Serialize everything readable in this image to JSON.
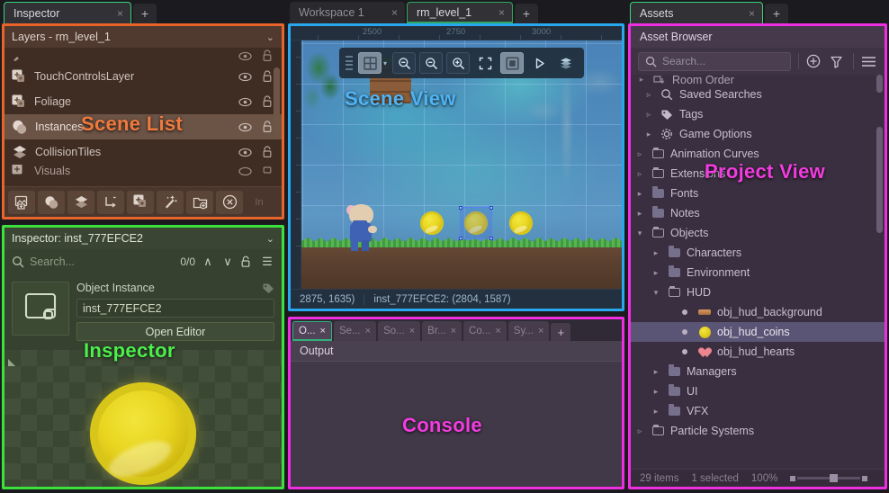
{
  "left_tabs": {
    "items": [
      {
        "label": "Inspector",
        "close": "×"
      }
    ],
    "add": "+"
  },
  "center_tabs": {
    "items": [
      {
        "label": "Workspace 1",
        "close": "×"
      },
      {
        "label": "rm_level_1",
        "close": "×"
      }
    ],
    "add": "+"
  },
  "right_tabs": {
    "items": [
      {
        "label": "Assets",
        "close": "×"
      }
    ],
    "add": "+"
  },
  "scene_list": {
    "overlay_label": "Scene List",
    "header": "Layers - rm_level_1",
    "collapse_icon": "⌄",
    "layers": [
      {
        "name": "",
        "icon": "brush",
        "partial": true,
        "eye": "👁",
        "lock": "🔓"
      },
      {
        "name": "TouchControlsLayer",
        "icon": "asset",
        "eye": "👁",
        "lock": "🔓"
      },
      {
        "name": "Foliage",
        "icon": "asset",
        "eye": "👁",
        "lock": "🔓"
      },
      {
        "name": "Instances",
        "icon": "instance",
        "selected": true,
        "eye": "👁",
        "lock": "🔓"
      },
      {
        "name": "CollisionTiles",
        "icon": "tile",
        "eye": "👁",
        "lock": "🔓"
      },
      {
        "name": "Visuals",
        "icon": "asset",
        "partial_bottom": true,
        "eye": "👁",
        "lock": "🔓"
      }
    ],
    "toolbar": [
      {
        "name": "background-layer-button",
        "icon": "image"
      },
      {
        "name": "instance-layer-button",
        "icon": "instance"
      },
      {
        "name": "tile-layer-button",
        "icon": "tiles"
      },
      {
        "name": "path-layer-button",
        "icon": "path"
      },
      {
        "name": "asset-layer-button",
        "icon": "asset"
      },
      {
        "name": "effect-layer-button",
        "icon": "wand"
      },
      {
        "name": "folder-layer-button",
        "icon": "folder-add"
      },
      {
        "name": "delete-layer-button",
        "icon": "delete"
      },
      {
        "name": "inherit-button",
        "icon": "text",
        "label": "In",
        "disabled": true
      }
    ]
  },
  "inspector": {
    "overlay_label": "Inspector",
    "header": "Inspector: inst_777EFCE2",
    "collapse_icon": "⌄",
    "search_placeholder": "Search...",
    "match_count": "0/0",
    "prev_icon": "∧",
    "next_icon": "∨",
    "lock_icon": "🔓",
    "menu_icon": "☰",
    "section_label": "Object Instance",
    "tag_icon": "tag",
    "name_value": "inst_777EFCE2",
    "open_editor_label": "Open Editor"
  },
  "scene_view": {
    "overlay_label": "Scene View",
    "ruler_ticks": [
      "2500",
      "2750",
      "3000"
    ],
    "toolbar": [
      {
        "name": "grid-toggle",
        "icon": "grid",
        "active": true,
        "caret": "▾"
      },
      {
        "name": "zoom-out-button",
        "icon": "zoom-out"
      },
      {
        "name": "zoom-reset-button",
        "icon": "zoom-minus"
      },
      {
        "name": "zoom-in-button",
        "icon": "zoom-in"
      },
      {
        "name": "fit-to-view-button",
        "icon": "frame"
      },
      {
        "name": "room-bounds-button",
        "icon": "square-inner",
        "active": true
      },
      {
        "name": "run-button",
        "icon": "play"
      },
      {
        "name": "layers-button",
        "icon": "stack"
      }
    ],
    "status_coords": "2875, 1635)",
    "status_instance": "inst_777EFCE2: (2804, 1587)"
  },
  "console": {
    "overlay_label": "Console",
    "tabs": [
      {
        "label": "O...",
        "close": "×",
        "active": true
      },
      {
        "label": "Se...",
        "close": "×"
      },
      {
        "label": "So...",
        "close": "×"
      },
      {
        "label": "Br...",
        "close": "×"
      },
      {
        "label": "Co...",
        "close": "×"
      },
      {
        "label": "Sy...",
        "close": "×"
      }
    ],
    "add": "+",
    "title": "Output"
  },
  "assets": {
    "overlay_label": "Project View",
    "header": "Asset Browser",
    "search_placeholder": "Search...",
    "add_icon": "⊕",
    "filter_icon": "filter",
    "menu_icon": "☰",
    "tree": [
      {
        "label": "Room Order",
        "indent": 0,
        "arrow": "▸",
        "icon": "rooms",
        "partial": true
      },
      {
        "label": "Saved Searches",
        "indent": 0,
        "arrow": "▹",
        "icon": "search"
      },
      {
        "label": "Tags",
        "indent": 0,
        "arrow": "▹",
        "icon": "tag"
      },
      {
        "label": "Game Options",
        "indent": 0,
        "arrow": "▸",
        "icon": "gear"
      },
      {
        "label": "Animation Curves",
        "indent": 0,
        "arrow": "▹",
        "icon": "folder-empty"
      },
      {
        "label": "Extensions",
        "indent": 0,
        "arrow": "▹",
        "icon": "folder-empty"
      },
      {
        "label": "Fonts",
        "indent": 0,
        "arrow": "▸",
        "icon": "folder"
      },
      {
        "label": "Notes",
        "indent": 0,
        "arrow": "▸",
        "icon": "folder"
      },
      {
        "label": "Objects",
        "indent": 0,
        "arrow": "▾",
        "icon": "folder-open"
      },
      {
        "label": "Characters",
        "indent": 1,
        "arrow": "▸",
        "icon": "folder"
      },
      {
        "label": "Environment",
        "indent": 1,
        "arrow": "▸",
        "icon": "folder"
      },
      {
        "label": "HUD",
        "indent": 1,
        "arrow": "▾",
        "icon": "folder-open"
      },
      {
        "label": "obj_hud_background",
        "indent": 2,
        "arrow": "",
        "icon": "dot",
        "swatch": "bar"
      },
      {
        "label": "obj_hud_coins",
        "indent": 2,
        "arrow": "",
        "icon": "dot",
        "swatch": "coin",
        "selected": true
      },
      {
        "label": "obj_hud_hearts",
        "indent": 2,
        "arrow": "",
        "icon": "dot",
        "swatch": "heart"
      },
      {
        "label": "Managers",
        "indent": 1,
        "arrow": "▸",
        "icon": "folder"
      },
      {
        "label": "UI",
        "indent": 1,
        "arrow": "▸",
        "icon": "folder"
      },
      {
        "label": "VFX",
        "indent": 1,
        "arrow": "▸",
        "icon": "folder"
      },
      {
        "label": "Particle Systems",
        "indent": 0,
        "arrow": "▹",
        "icon": "folder-empty"
      }
    ],
    "status": {
      "items": "29 items",
      "selected": "1 selected",
      "zoom": "100%"
    }
  },
  "colors": {
    "scene_list_outline": "#e8642a",
    "inspector_outline": "#3de13d",
    "scene_view_outline": "#29a8ee",
    "console_outline": "#ee2ee0",
    "assets_outline": "#ee2ee0"
  }
}
